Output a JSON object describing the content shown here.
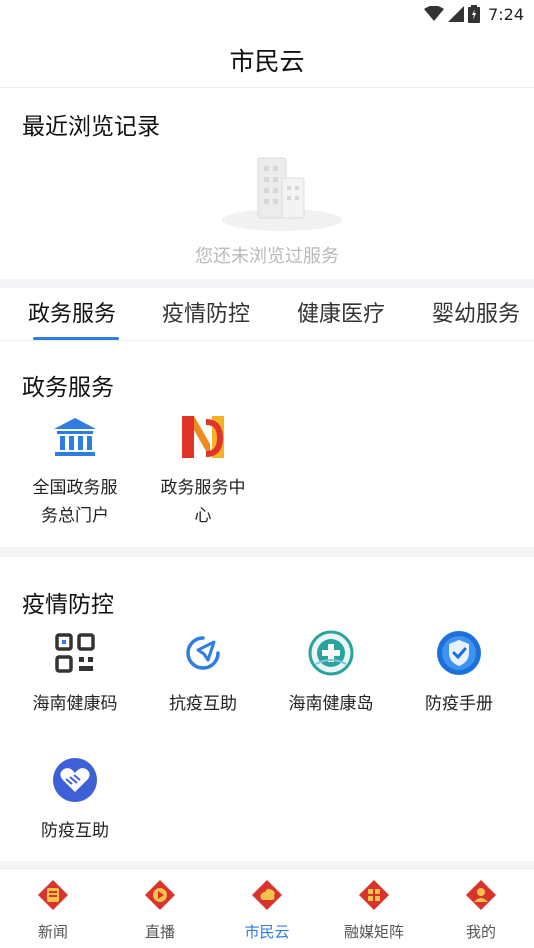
{
  "status_bar": {
    "time": "7:24",
    "icons": [
      "wifi-icon",
      "cell-signal-icon",
      "battery-icon"
    ]
  },
  "app_bar": {
    "title": "市民云"
  },
  "recent": {
    "title": "最近浏览记录",
    "empty_text": "您还未浏览过服务"
  },
  "tabs": [
    {
      "label": "政务服务",
      "active": true
    },
    {
      "label": "疫情防控",
      "active": false
    },
    {
      "label": "健康医疗",
      "active": false
    },
    {
      "label": "婴幼服务",
      "active": false
    }
  ],
  "sections": [
    {
      "title": "政务服务",
      "items": [
        {
          "label_line1": "全国政务服",
          "label_line2": "务总门户",
          "icon": "bank-icon"
        },
        {
          "label_line1": "政务服务中",
          "label_line2": "心",
          "icon": "n-logo-icon"
        }
      ]
    },
    {
      "title": "疫情防控",
      "items": [
        {
          "label": "海南健康码",
          "icon": "qr-code-icon"
        },
        {
          "label": "抗疫互助",
          "icon": "send-circle-icon"
        },
        {
          "label": "海南健康岛",
          "icon": "health-island-icon"
        },
        {
          "label": "防疫手册",
          "icon": "shield-icon"
        },
        {
          "label": "防疫互助",
          "icon": "handshake-heart-icon"
        }
      ]
    }
  ],
  "bottom_nav": [
    {
      "label": "新闻",
      "active": false,
      "icon": "news-icon"
    },
    {
      "label": "直播",
      "active": false,
      "icon": "live-icon"
    },
    {
      "label": "市民云",
      "active": true,
      "icon": "citizen-cloud-icon"
    },
    {
      "label": "融媒矩阵",
      "active": false,
      "icon": "media-matrix-icon"
    },
    {
      "label": "我的",
      "active": false,
      "icon": "profile-icon"
    }
  ],
  "colors": {
    "accent": "#2f7de1",
    "nav_icon_red": "#d8332c",
    "nav_icon_gold": "#f3c24a",
    "divider": "#f4f4f6"
  }
}
